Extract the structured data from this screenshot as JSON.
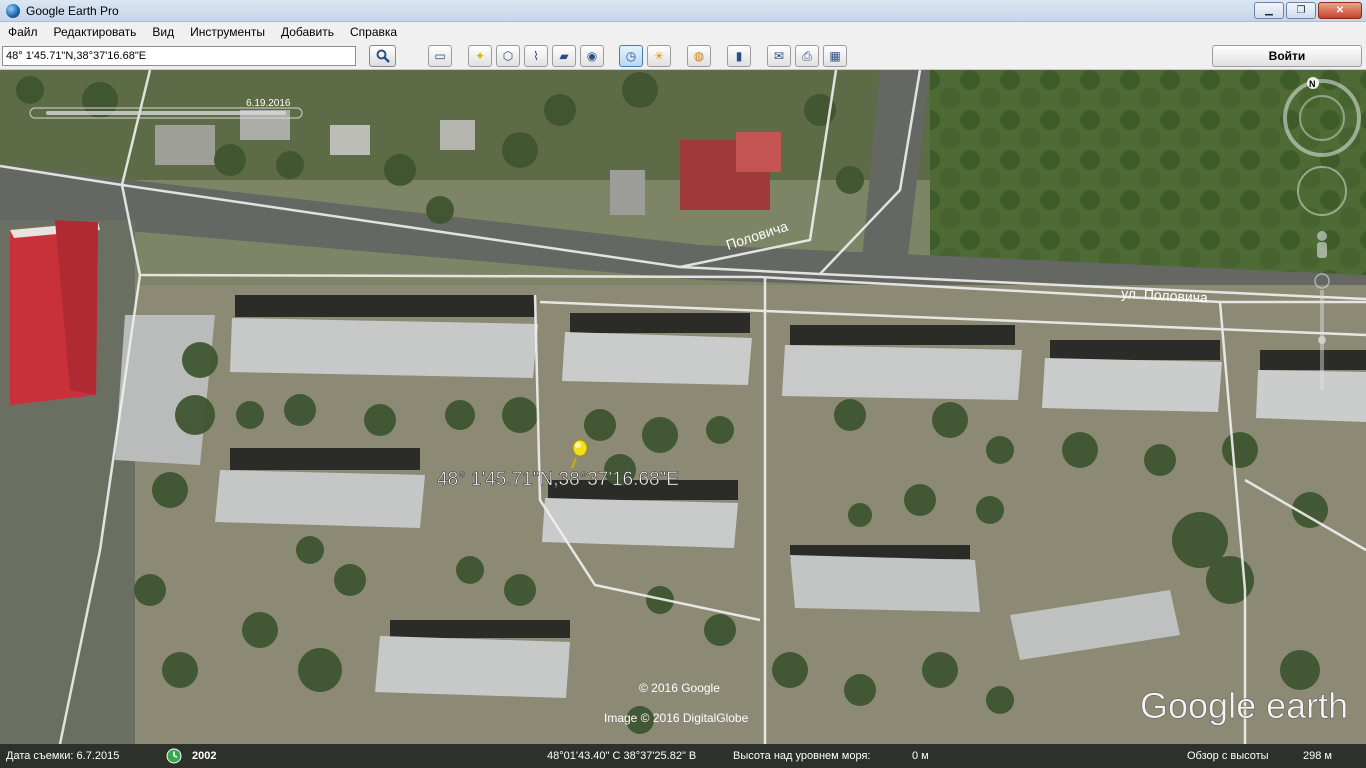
{
  "window": {
    "title": "Google Earth Pro"
  },
  "menu": {
    "items": [
      "Файл",
      "Редактировать",
      "Вид",
      "Инструменты",
      "Добавить",
      "Справка"
    ]
  },
  "search": {
    "value": "48° 1'45.71\"N,38°37'16.68\"E"
  },
  "toolbar": {
    "signin_label": "Войти"
  },
  "map": {
    "timeslider_date": "6.19.2016",
    "placemark_label": "48° 1'45.71\"N,38°37'16.68\"E",
    "street_label_1": "Половича",
    "street_label_2": "ул. Половича",
    "copyright_google": "© 2016 Google",
    "copyright_image": "Image © 2016 DigitalGlobe",
    "logo": "Google earth",
    "compass_north": "N"
  },
  "status": {
    "capture_date": "Дата съемки: 6.7.2015",
    "history_year": "2002",
    "coords": "48°01'43.40\" С  38°37'25.82\" В",
    "elevation_label": "Высота над уровнем моря:",
    "elevation_value": "0 м",
    "eye_alt_label": "Обзор с высоты",
    "eye_alt_value": "298 м"
  },
  "colors": {
    "road_line": "#ffffff",
    "pin": "#f2e01c",
    "roof": "#c7c9c9",
    "red_roof": "#c8313a"
  }
}
